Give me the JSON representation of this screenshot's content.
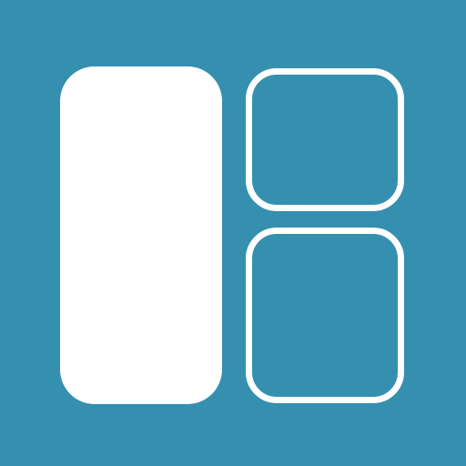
{
  "icon": {
    "name": "sidebar-layout-icon",
    "colors": {
      "background": "#3490ae",
      "foreground": "#ffffff"
    },
    "panels": [
      {
        "name": "main-panel",
        "style": "filled"
      },
      {
        "name": "top-right-panel",
        "style": "outlined"
      },
      {
        "name": "bottom-right-panel",
        "style": "outlined"
      }
    ]
  }
}
